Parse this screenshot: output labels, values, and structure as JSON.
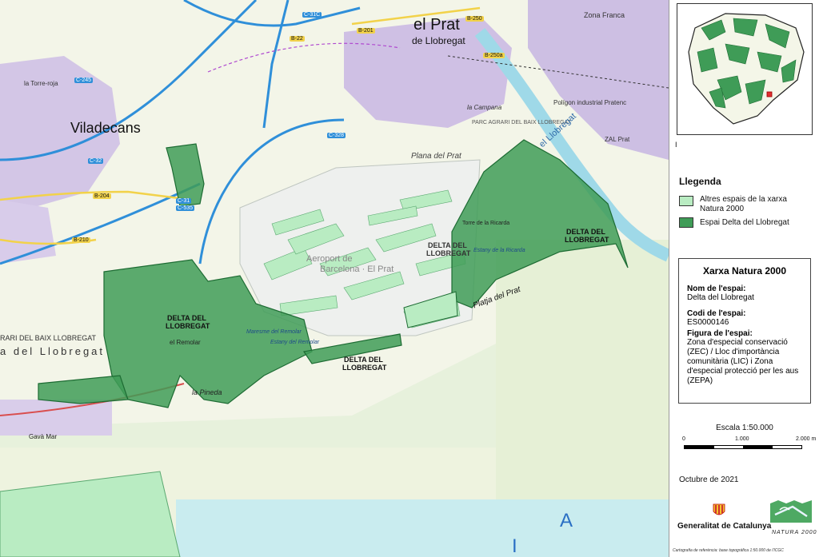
{
  "map": {
    "place_labels": {
      "elprat_1": "el Prat",
      "elprat_2": "de Llobregat",
      "viladecans": "Viladecans",
      "zona_franca": "Zona Franca",
      "parc_agrari": "PARC AGRARI DEL BAIX LLOBREGAT",
      "plana_prat": "Plana del Prat",
      "aeroport_1": "Aeroport de",
      "aeroport_2": "Barcelona · El Prat",
      "delta1_1": "DELTA DEL",
      "delta1_2": "LLOBREGAT",
      "delta2_1": "DELTA DEL",
      "delta2_2": "LLOBREGAT",
      "delta3_1": "DELTA DEL",
      "delta3_2": "LLOBREGAT",
      "delta4_1": "DELTA DEL",
      "delta4_2": "LLOBREGAT",
      "el_llobregat": "el Llobregat",
      "platja_prat": "Platja del Prat",
      "la_pineda": "la Pineda",
      "gava_mar": "Gavà Mar",
      "el_remolar": "el Remolar",
      "torre_ricarda": "Torre de la Ricarda",
      "estany_ricarda": "Estany de la Ricarda",
      "maresme_remolar": "Maresme del Remolar",
      "estany_remolar": "Estany del Remolar",
      "rarl_baix": "RARI DEL BAIX LLOBREGAT",
      "delta_llobregat_left": "a  del  Llobregat",
      "la_torre_roja": "la Torre-roja",
      "la_campana": "la Campana",
      "poligon_pratenc": "Polígon industrial Pratenc",
      "zal_prat": "ZAL Prat",
      "sea_letter_1": "A",
      "sea_letter_2": "I"
    },
    "road_labels": [
      "C-31C",
      "B-22",
      "B-201",
      "B-250",
      "C-32",
      "B-204",
      "B-210",
      "C-245",
      "C-31",
      "C-328",
      "C-535",
      "B-250a"
    ],
    "colors": {
      "natura_other": "#b9ecc2",
      "natura_delta": "#3f9c57",
      "natura_delta_edge": "#1d6b33",
      "urban": "#c9b9e0",
      "sea_light": "#d9f2f0",
      "sea": "#c4e8ef",
      "road_blue": "#2f8fd9",
      "road_yellow": "#f2d24a"
    }
  },
  "inset": {
    "scale_mark": "I"
  },
  "legend": {
    "title": "Llegenda",
    "items": [
      {
        "label": "Altres espais de la xarxa Natura 2000",
        "color": "#b9ecc2"
      },
      {
        "label": "Espai Delta del Llobregat",
        "color": "#3f9c57"
      }
    ]
  },
  "info": {
    "title": "Xarxa Natura 2000",
    "name_key": "Nom de l'espai:",
    "name_val": "Delta del Llobregat",
    "code_key": "Codi de l'espai:",
    "code_val": "ES0000146",
    "fig_key": "Figura de l'espai:",
    "fig_val": "Zona d'especial conservació (ZEC) / Lloc d'importància comunitària (LIC) i Zona d'especial protecció per les aus (ZEPA)"
  },
  "scale": {
    "title": "Escala 1:50.000",
    "ticks": [
      "0",
      "1.000",
      "2.000 m"
    ]
  },
  "date": "Octubre de 2021",
  "footer": {
    "institution": "Generalitat de Catalunya",
    "natura_logo": "NATURA 2000",
    "credit": "Cartografia de referència: base topogràfica 1:50.000 de l'ICGC"
  }
}
